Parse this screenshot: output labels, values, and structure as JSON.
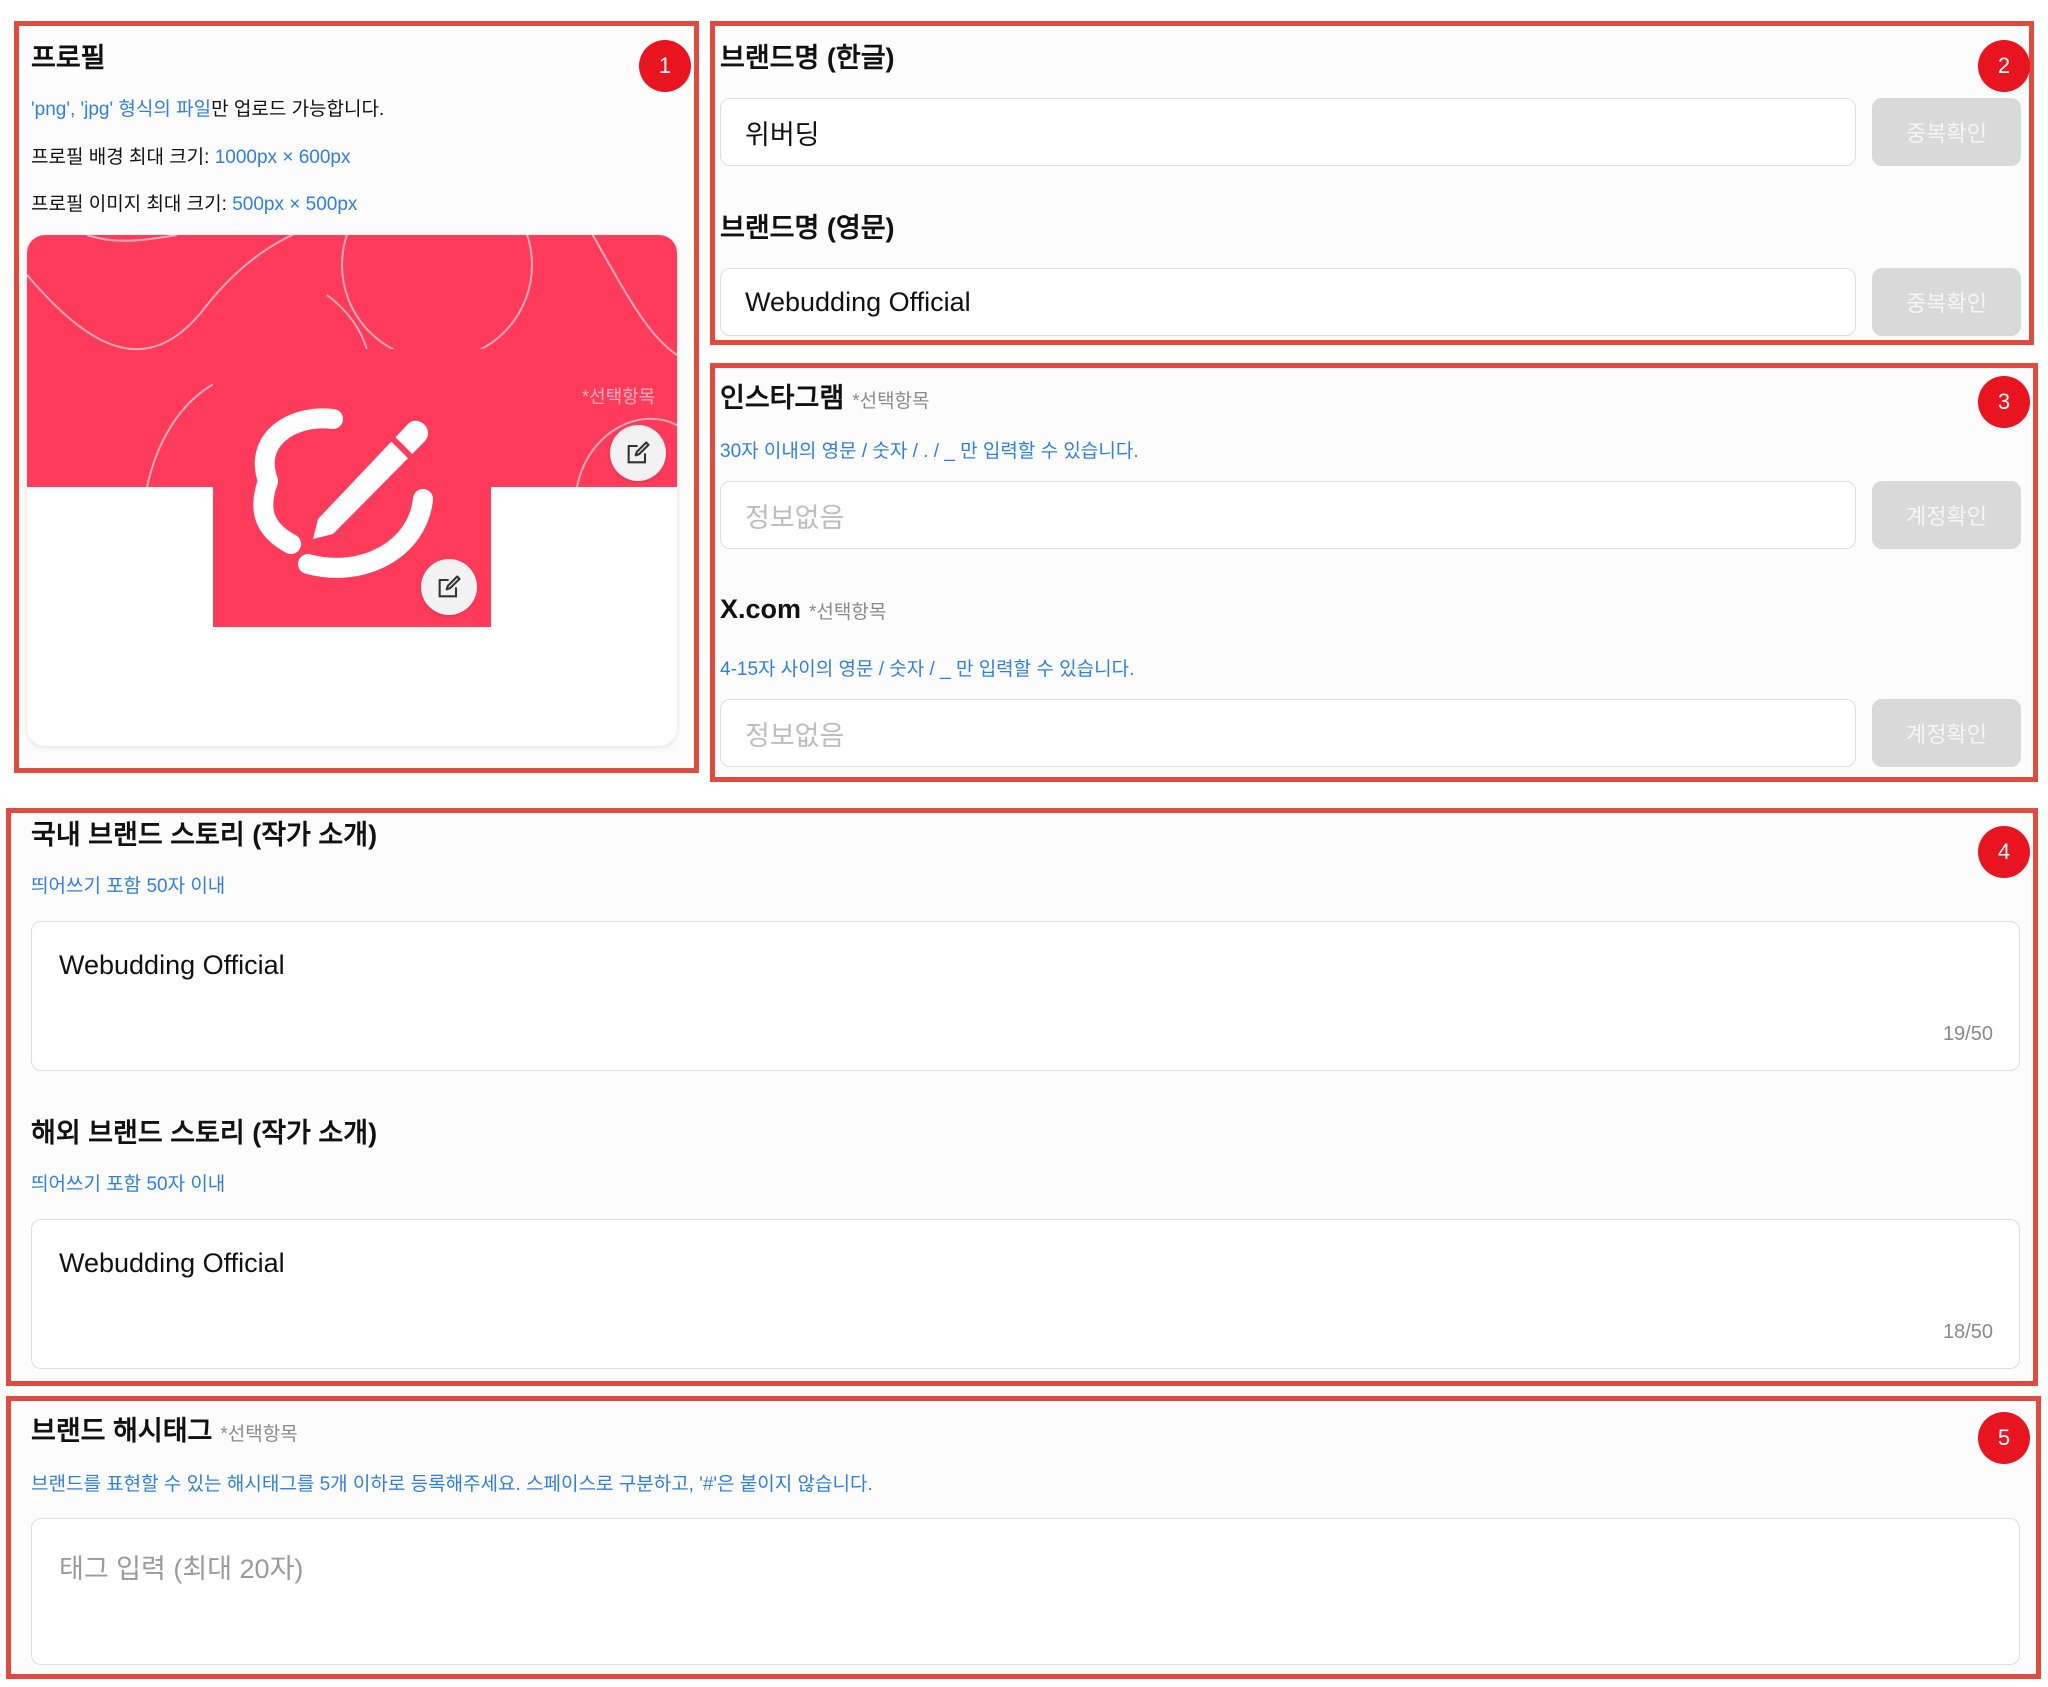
{
  "colors": {
    "frame": "#e04a3f",
    "badge": "#e8141f",
    "accent_blue": "#2f7fe0",
    "brand_pink": "#ff3b5c",
    "button_disabled": "#d9d9d9"
  },
  "badges": [
    "1",
    "2",
    "3",
    "4",
    "5"
  ],
  "profile": {
    "title": "프로필",
    "hint_file_types": "'png', 'jpg' 형식의 파일",
    "hint_file_suffix": "만 업로드 가능합니다.",
    "bg_size_label": "프로필 배경 최대 크기: ",
    "bg_size_value": "1000px × 600px",
    "img_size_label": "프로필 이미지 최대 크기: ",
    "img_size_value": "500px × 500px",
    "optional_tag": "*선택항목",
    "edit_icon": "pencil-square-icon"
  },
  "brand_name": {
    "ko_title": "브랜드명 (한글)",
    "ko_value": "위버딩",
    "ko_button": "중복확인",
    "en_title": "브랜드명 (영문)",
    "en_value": "Webudding Official",
    "en_button": "중복확인"
  },
  "social": {
    "instagram_title": "인스타그램",
    "instagram_optional": "*선택항목",
    "instagram_hint": "30자 이내의 영문 / 숫자 / . / _ 만 입력할 수 있습니다.",
    "instagram_placeholder": "정보없음",
    "instagram_button": "계정확인",
    "x_title": "X.com",
    "x_optional": "*선택항목",
    "x_hint": "4-15자 사이의 영문 / 숫자 / _ 만 입력할 수 있습니다.",
    "x_placeholder": "정보없음",
    "x_button": "계정확인"
  },
  "story": {
    "domestic_title": "국내 브랜드 스토리 (작가 소개)",
    "domestic_hint": "띄어쓰기 포함 50자 이내",
    "domestic_value": "Webudding Official",
    "domestic_count": "19/50",
    "overseas_title": "해외 브랜드 스토리 (작가 소개)",
    "overseas_hint": "띄어쓰기 포함 50자 이내",
    "overseas_value": "Webudding Official",
    "overseas_count": "18/50"
  },
  "hashtag": {
    "title": "브랜드 해시태그",
    "optional": "*선택항목",
    "hint": "브랜드를 표현할 수 있는 해시태그를 5개 이하로 등록해주세요. 스페이스로 구분하고, '#'은 붙이지 않습니다.",
    "placeholder": "태그 입력 (최대 20자)"
  }
}
